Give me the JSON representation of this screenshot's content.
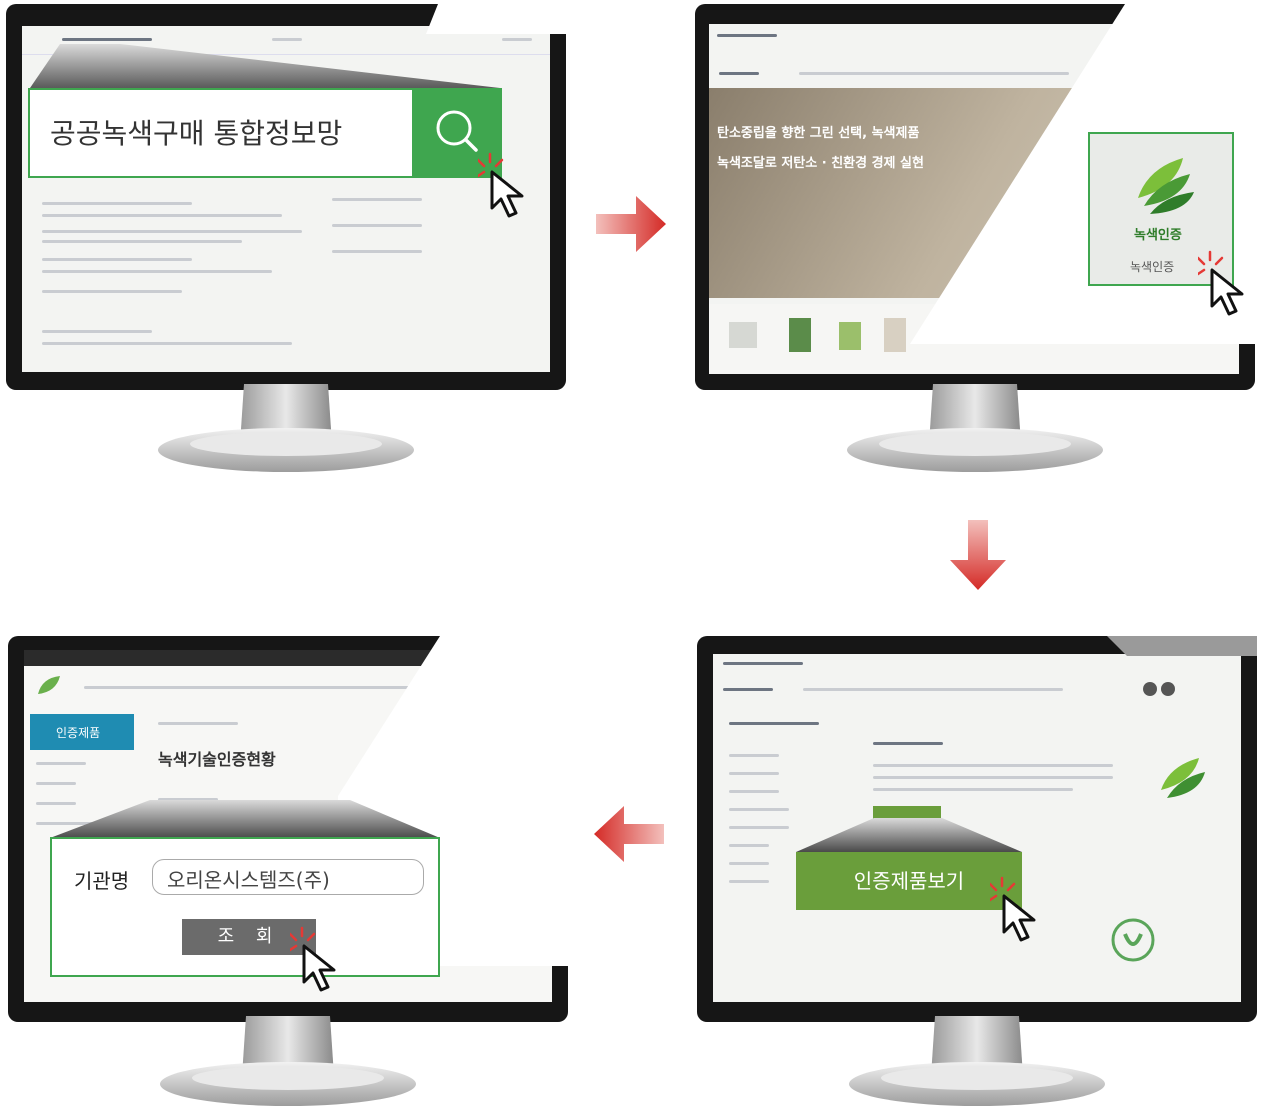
{
  "step1": {
    "search_text": "공공녹색구매 통합정보망",
    "icon": "search-icon"
  },
  "step2": {
    "hero_line1": "탄소중립을 향한 그린 선택, 녹색제품",
    "hero_line2": "녹색조달로 저탄소 · 친환경 경제 실현",
    "mark_label": "녹색인증"
  },
  "step3": {
    "button_label": "인증제품보기"
  },
  "step4": {
    "sidebar_label": "인증제품",
    "page_title": "녹색기술인증현황",
    "field_label": "기관명",
    "field_value": "오리온시스템즈(주)",
    "submit_label": "조 회"
  },
  "colors": {
    "accent_green": "#3fa64f",
    "button_green": "#6a9e3b",
    "arrow_red": "#d42a26",
    "bezel": "#161616"
  }
}
